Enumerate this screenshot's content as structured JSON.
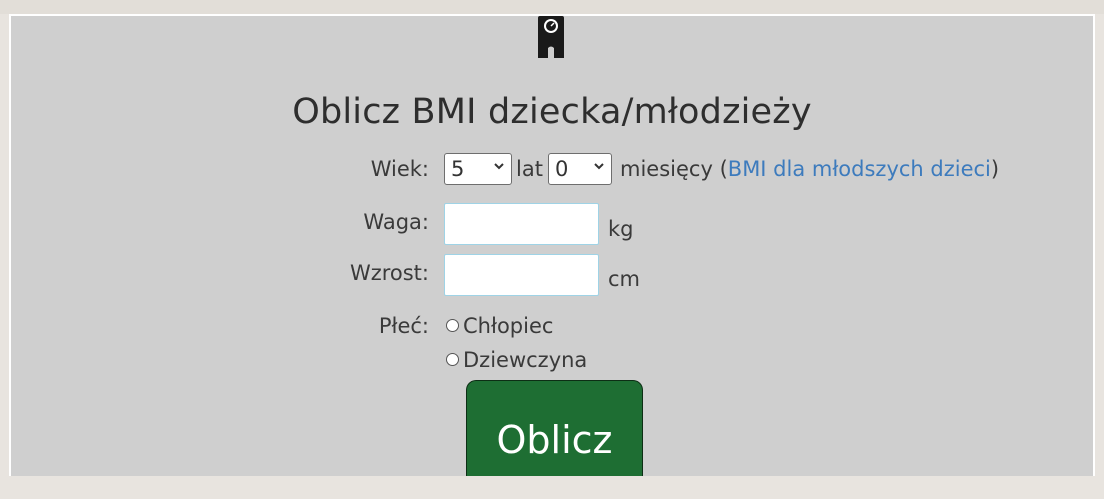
{
  "title": "Oblicz BMI dziecka/młodzieży",
  "age": {
    "label": "Wiek:",
    "years_value": "5",
    "years_unit": "lat",
    "months_value": "0",
    "months_unit": "miesięcy",
    "link_open": "(",
    "link_text": "BMI dla młodszych dzieci",
    "link_close": ")"
  },
  "weight": {
    "label": "Waga:",
    "value": "",
    "unit": "kg"
  },
  "height": {
    "label": "Wzrost:",
    "value": "",
    "unit": "cm"
  },
  "gender": {
    "label": "Płeć:",
    "options": [
      "Chłopiec",
      "Dziewczyna"
    ]
  },
  "submit_label": "Oblicz",
  "icons": {
    "logo": "scale-icon",
    "dropdown": "chevron-down-icon"
  },
  "colors": {
    "button": "#1e6e33",
    "link": "#3d7bbd",
    "background": "#cfcfcf"
  }
}
